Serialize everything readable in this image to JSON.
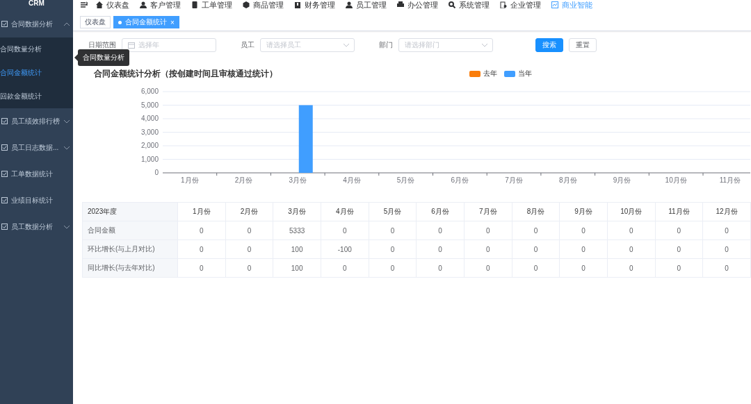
{
  "sidebar": {
    "brand": "CRM",
    "groups": [
      {
        "label": "合同数据分析",
        "kind": "submenu",
        "expanded": true,
        "children": [
          {
            "label": "合同数量分析",
            "selected": false
          },
          {
            "label": "合同金额统计",
            "selected": true
          },
          {
            "label": "回款金额统计",
            "selected": false
          }
        ]
      },
      {
        "label": "员工绩效排行榜",
        "kind": "submenu",
        "expanded": false
      },
      {
        "label": "员工日志数据...",
        "kind": "submenu",
        "expanded": false
      },
      {
        "label": "工单数据统计",
        "kind": "item"
      },
      {
        "label": "业绩目标统计",
        "kind": "item"
      },
      {
        "label": "员工数据分析",
        "kind": "submenu",
        "expanded": false
      }
    ]
  },
  "tooltip": {
    "text": "合同数量分析"
  },
  "topnav": {
    "items": [
      {
        "label": "仪表盘",
        "selected": false
      },
      {
        "label": "客户管理",
        "selected": false
      },
      {
        "label": "工单管理",
        "selected": false
      },
      {
        "label": "商品管理",
        "selected": false
      },
      {
        "label": "财务管理",
        "selected": false
      },
      {
        "label": "员工管理",
        "selected": false
      },
      {
        "label": "办公管理",
        "selected": false
      },
      {
        "label": "系统管理",
        "selected": false
      },
      {
        "label": "企业管理",
        "selected": false
      },
      {
        "label": "商业智能",
        "selected": true
      }
    ]
  },
  "tabs": [
    {
      "label": "仪表盘",
      "selected": false
    },
    {
      "label": "合同金额统计",
      "selected": true,
      "close": "×"
    }
  ],
  "filters": {
    "fields": [
      {
        "label": "日期范围",
        "placeholder": "选择年",
        "kind": "date"
      },
      {
        "label": "员工",
        "placeholder": "请选择员工",
        "kind": "select"
      },
      {
        "label": "部门",
        "placeholder": "请选择部门",
        "kind": "select"
      }
    ],
    "buttons": [
      {
        "label": "搜索",
        "kind": "primary"
      },
      {
        "label": "重置",
        "kind": "default"
      }
    ]
  },
  "chart": {
    "title": "合同金额统计分析（按创建时间且审核通过统计）",
    "chart_data": {
      "type": "bar",
      "categories": [
        "1月份",
        "2月份",
        "3月份",
        "4月份",
        "5月份",
        "6月份",
        "7月份",
        "8月份",
        "9月份",
        "10月份",
        "11月份"
      ],
      "series": [
        {
          "name": "去年",
          "color": "#fa7d0b",
          "values": [
            0,
            0,
            0,
            0,
            0,
            0,
            0,
            0,
            0,
            0,
            0
          ]
        },
        {
          "name": "当年",
          "color": "#409eff",
          "values": [
            0,
            0,
            5000,
            0,
            0,
            0,
            0,
            0,
            0,
            0,
            0
          ]
        }
      ],
      "ylim": [
        0,
        6000
      ],
      "grid": true,
      "yticks": [
        {
          "value": 0,
          "label": "0"
        },
        {
          "value": 1000,
          "label": "1,000"
        },
        {
          "value": 2000,
          "label": "2,000"
        },
        {
          "value": 3000,
          "label": "3,000"
        },
        {
          "value": 4000,
          "label": "4,000"
        },
        {
          "value": 5000,
          "label": "5,000"
        },
        {
          "value": 6000,
          "label": "6,000"
        }
      ]
    }
  },
  "table": {
    "columns": [
      "2023年度",
      "1月份",
      "2月份",
      "3月份",
      "4月份",
      "5月份",
      "6月份",
      "7月份",
      "8月份",
      "9月份",
      "10月份",
      "11月份",
      "12月份"
    ],
    "rows": [
      [
        "合同金额",
        "0",
        "0",
        "5333",
        "0",
        "0",
        "0",
        "0",
        "0",
        "0",
        "0",
        "0",
        "0"
      ],
      [
        "环比增长(与上月对比)",
        "0",
        "0",
        "100",
        "-100",
        "0",
        "0",
        "0",
        "0",
        "0",
        "0",
        "0",
        "0"
      ],
      [
        "同比增长(与去年对比)",
        "0",
        "0",
        "100",
        "0",
        "0",
        "0",
        "0",
        "0",
        "0",
        "0",
        "0",
        "0"
      ]
    ]
  }
}
